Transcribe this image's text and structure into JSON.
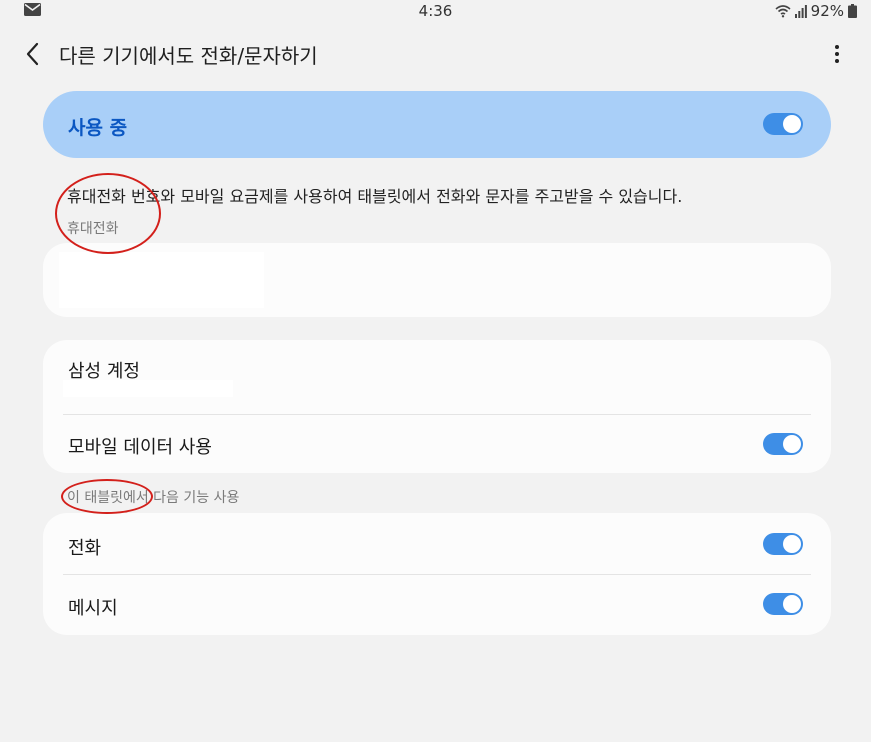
{
  "status_bar": {
    "time": "4:36",
    "battery": "92%"
  },
  "header": {
    "title": "다른 기기에서도 전화/문자하기"
  },
  "master_switch": {
    "label": "사용 중",
    "on": true
  },
  "description": "휴대전화 번호와 모바일 요금제를 사용하여 태블릿에서 전화와 문자를 주고받을 수 있습니다.",
  "phone_section": {
    "header": "휴대전화"
  },
  "account_section": {
    "account_label": "삼성 계정",
    "mobile_data_label": "모바일 데이터 사용",
    "mobile_data_on": true
  },
  "features_section": {
    "header": "이 태블릿에서 다음 기능 사용",
    "items": [
      {
        "label": "전화",
        "on": true
      },
      {
        "label": "메시지",
        "on": true
      }
    ]
  },
  "colors": {
    "accent": "#3e8ee6",
    "master_bg": "#a9cff8",
    "annotation": "#d3201b"
  }
}
